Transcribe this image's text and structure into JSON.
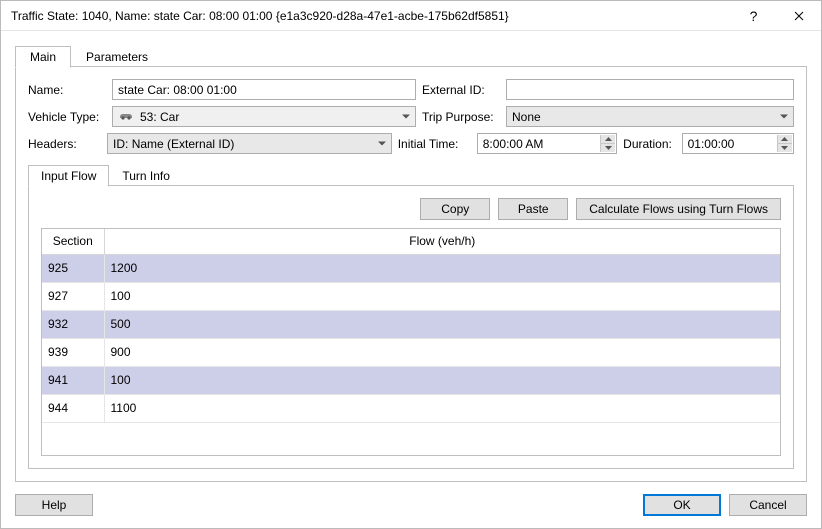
{
  "window": {
    "title": "Traffic State: 1040, Name: state Car: 08:00 01:00  {e1a3c920-d28a-47e1-acbe-175b62df5851}",
    "help_tooltip": "?",
    "close_tooltip": "Close"
  },
  "outer_tabs": {
    "main": "Main",
    "parameters": "Parameters"
  },
  "form": {
    "name_label": "Name:",
    "name_value": "state Car: 08:00 01:00",
    "external_id_label": "External ID:",
    "external_id_value": "",
    "vehicle_type_label": "Vehicle Type:",
    "vehicle_type_value": "53: Car",
    "vehicle_type_icon": "car-icon",
    "trip_purpose_label": "Trip Purpose:",
    "trip_purpose_value": "None",
    "headers_label": "Headers:",
    "headers_value": "ID: Name (External ID)",
    "initial_time_label": "Initial Time:",
    "initial_time_value": "8:00:00 AM",
    "duration_label": "Duration:",
    "duration_value": "01:00:00"
  },
  "inner_tabs": {
    "input_flow": "Input Flow",
    "turn_info": "Turn Info"
  },
  "toolbar": {
    "copy": "Copy",
    "paste": "Paste",
    "calc": "Calculate Flows using Turn Flows"
  },
  "table": {
    "col_section": "Section",
    "col_flow": "Flow (veh/h)",
    "rows": [
      {
        "section": "925",
        "flow": "1200"
      },
      {
        "section": "927",
        "flow": "100"
      },
      {
        "section": "932",
        "flow": "500"
      },
      {
        "section": "939",
        "flow": "900"
      },
      {
        "section": "941",
        "flow": "100"
      },
      {
        "section": "944",
        "flow": "1100"
      }
    ]
  },
  "footer": {
    "help": "Help",
    "ok": "OK",
    "cancel": "Cancel"
  }
}
